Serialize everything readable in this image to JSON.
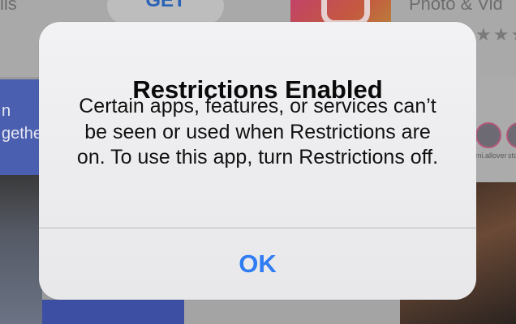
{
  "background": {
    "left_header_fragment": "ils",
    "get_button_label": "GET",
    "right_header_fragment": "Photo & Vid",
    "rating_stars": "★★★",
    "banner_line_1": "n",
    "banner_line_2": "gethe",
    "avatar_1_label": "mi.allover",
    "avatar_2_label": "sto"
  },
  "alert": {
    "title": "Restrictions Enabled",
    "message": "Certain apps, features, or services can’t be seen or used when Restrictions are on. To use this app, turn Restrictions off.",
    "ok_label": "OK"
  },
  "colors": {
    "accent": "#2f7cf3",
    "dim_overlay": "#9a9a9a"
  }
}
